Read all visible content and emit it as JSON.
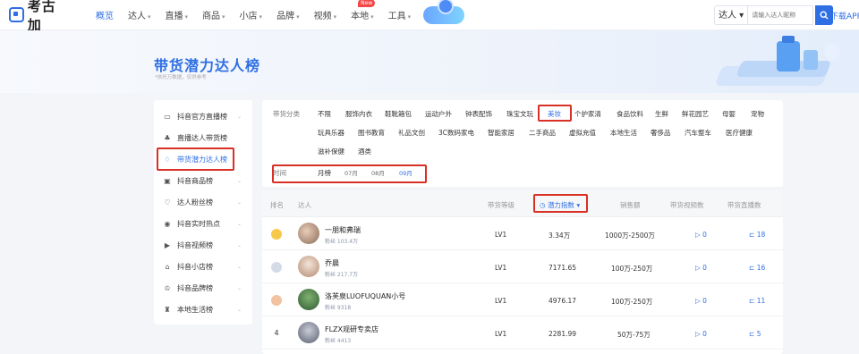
{
  "header": {
    "logo_text": "考古加",
    "nav": [
      {
        "label": "概览",
        "active": true,
        "caret": false
      },
      {
        "label": "达人",
        "caret": true
      },
      {
        "label": "直播",
        "caret": true
      },
      {
        "label": "商品",
        "caret": true
      },
      {
        "label": "小店",
        "caret": true
      },
      {
        "label": "品牌",
        "caret": true
      },
      {
        "label": "视频",
        "caret": true
      },
      {
        "label": "本地",
        "caret": true,
        "badge": "New"
      },
      {
        "label": "工具",
        "caret": true
      }
    ],
    "search": {
      "scope": "达人",
      "placeholder": "请输入达人昵称"
    },
    "download_label": "下载APP"
  },
  "hero": {
    "title": "带货潜力达人榜",
    "subtitle": "*依托万数据，仅供参考"
  },
  "sidebar": {
    "items": [
      {
        "label": "抖音官方直播榜",
        "icon": "live-tv-icon",
        "chevron": true
      },
      {
        "label": "直播达人带货榜",
        "icon": "people-icon",
        "chevron": false
      },
      {
        "label": "带货潜力达人榜",
        "icon": "trophy-icon",
        "chevron": false,
        "active": true
      },
      {
        "label": "抖音商品榜",
        "icon": "goods-icon",
        "chevron": true
      },
      {
        "label": "达人粉丝榜",
        "icon": "heart-icon",
        "chevron": true
      },
      {
        "label": "抖音实时热点",
        "icon": "fire-icon",
        "chevron": true
      },
      {
        "label": "抖音视频榜",
        "icon": "video-icon",
        "chevron": true
      },
      {
        "label": "抖音小店榜",
        "icon": "shop-icon",
        "chevron": true
      },
      {
        "label": "抖音品牌榜",
        "icon": "brand-icon",
        "chevron": true
      },
      {
        "label": "本地生活榜",
        "icon": "local-life-icon",
        "chevron": true
      }
    ]
  },
  "filters": {
    "category_label": "带货分类",
    "categories_row1": [
      "不限",
      "服饰内衣",
      "鞋靴箱包",
      "运动户外",
      "钟表配饰",
      "珠宝文玩",
      "美妆",
      "个护家清",
      "食品饮料",
      "生鲜",
      "鲜花园艺",
      "母婴",
      "宠物"
    ],
    "categories_row2": [
      "玩具乐器",
      "图书教育",
      "礼品文创",
      "3C数码家电",
      "智能家居",
      "二手商品",
      "虚拟充值",
      "本地生活",
      "奢侈品",
      "汽车整车",
      "医疗健康"
    ],
    "categories_row3": [
      "滋补保健",
      "酒类"
    ],
    "selected_category": "美妆",
    "time_label": "时间",
    "times": [
      "月榜",
      "07月",
      "08月",
      "09月"
    ],
    "selected_time": "09月"
  },
  "table": {
    "headers": {
      "rank": "排名",
      "talent": "达人",
      "level": "带货等级",
      "potential": "潜力指数",
      "sales": "销售额",
      "video_count": "带货视频数",
      "live_count": "带货直播数"
    },
    "rows": [
      {
        "rank": "1",
        "name": "一朋和弗瑞",
        "fans": "粉丝 103.4万",
        "level": "LV1",
        "potential": "3.34万",
        "sales": "1000万-2500万",
        "video": "0",
        "live": "18"
      },
      {
        "rank": "2",
        "name": "乔晨",
        "fans": "粉丝 217.7万",
        "level": "LV1",
        "potential": "7171.65",
        "sales": "100万-250万",
        "video": "0",
        "live": "16"
      },
      {
        "rank": "3",
        "name": "洛芙泉LUOFUQUAN小号",
        "fans": "粉丝 9318",
        "level": "LV1",
        "potential": "4976.17",
        "sales": "100万-250万",
        "video": "0",
        "live": "11"
      },
      {
        "rank": "4",
        "name": "FLZX观研专卖店",
        "fans": "粉丝 4413",
        "level": "LV1",
        "potential": "2281.99",
        "sales": "50万-75万",
        "video": "0",
        "live": "5"
      }
    ]
  },
  "colors": {
    "accent": "#2f6fe4",
    "highlight": "#d93025"
  }
}
